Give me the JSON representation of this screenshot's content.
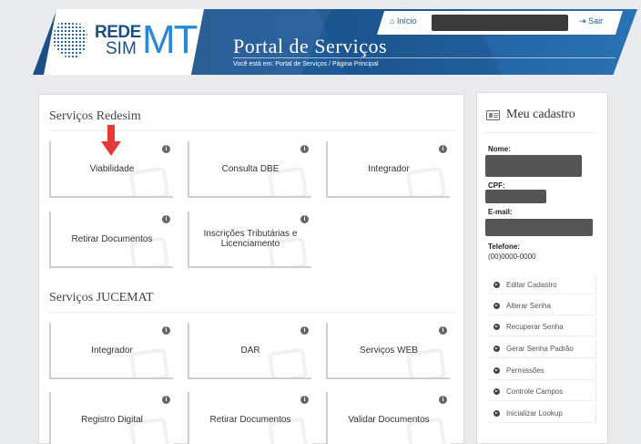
{
  "header": {
    "portal_title": "Portal de Serviços",
    "breadcrumb": "Você está em: Portal de Serviços / Página Principal",
    "logo": {
      "rede": "REDE",
      "sim": "SIM",
      "mt": "MT"
    },
    "nav": {
      "inicio": "Início",
      "sair": "Sair",
      "inicio_icon": "home-icon",
      "sair_icon": "sign-out-icon"
    }
  },
  "redesim": {
    "title": "Serviços Redesim",
    "tiles": [
      "Viabilidade",
      "Consulta DBE",
      "Integrador",
      "Retirar Documentos",
      "Inscrições Tributárias e Licenciamento"
    ]
  },
  "jucemat": {
    "title": "Serviços JUCEMAT",
    "tiles": [
      "Integrador",
      "DAR",
      "Serviços WEB",
      "Registro Digital",
      "Retirar Documentos",
      "Validar Documentos"
    ]
  },
  "tile_info": "i",
  "profile": {
    "title": "Meu cadastro",
    "icon": "id-card-icon",
    "nome_label": "Nome:",
    "cpf_label": "CPF:",
    "email_label": "E-mail:",
    "telefone_label": "Telefone:",
    "telefone_value": "(00)0000-0000",
    "actions": [
      "Editar Cadastro",
      "Alterar Senha",
      "Recuperar Senha",
      "Gerar Senha Padrão",
      "Permissões",
      "Controle Campos",
      "Inicializar Lookup"
    ]
  },
  "colors": {
    "header_blue": "#1f5c9a",
    "accent_light_blue": "#2a8ad8",
    "arrow_red": "#e53935",
    "background": "#e9ebee"
  }
}
